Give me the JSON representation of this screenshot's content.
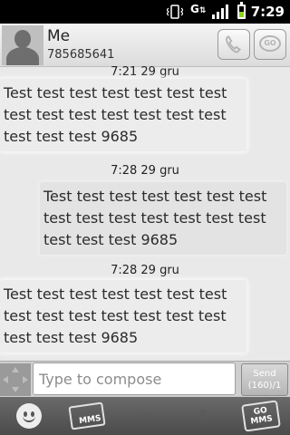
{
  "status_bar": {
    "time": "7:29",
    "icons": [
      "vibrate-icon",
      "data-transfer-icon",
      "signal-icon",
      "battery-icon"
    ],
    "data_label": "G"
  },
  "contact": {
    "name": "Me",
    "number": "785685641",
    "call_icon": "phone-icon",
    "go_icon": "go-chat-icon",
    "go_label": "GO"
  },
  "messages": [
    {
      "timestamp": "7:21 29 gru",
      "direction": "incoming",
      "text": "Test test test test test test test test test test test test test test test test test 9685"
    },
    {
      "timestamp": "7:28 29 gru",
      "direction": "outgoing",
      "text": "Test test test test test test test test test test test test test test test test test 9685"
    },
    {
      "timestamp": "7:28 29 gru",
      "direction": "incoming",
      "text": "Test test test test test test test test test test test test test test test test test 9685"
    }
  ],
  "compose": {
    "placeholder": "Type to compose",
    "send_label": "Send",
    "send_counter": "(160)/1"
  },
  "toolbar": {
    "items": [
      "emoji-icon",
      "mms-attach-icon",
      "back-icon",
      "down-icon",
      "go-mms-icon"
    ],
    "mms_label": "MMS",
    "go_mms_label": "GO MMS"
  },
  "colors": {
    "battery_fill": "#8ad51a",
    "background": "#e9e9e9"
  }
}
